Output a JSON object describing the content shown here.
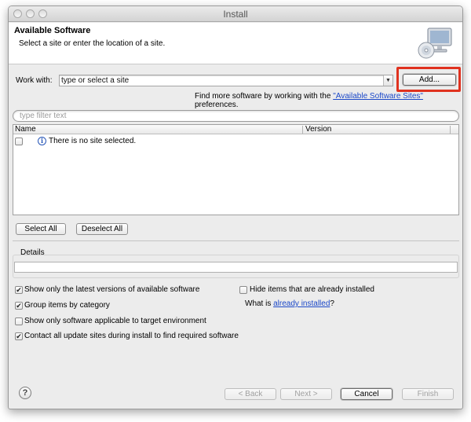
{
  "window": {
    "title": "Install"
  },
  "header": {
    "title": "Available Software",
    "subtitle": "Select a site or enter the location of a site.",
    "icon": "computer-cd-icon"
  },
  "work_with": {
    "label": "Work with:",
    "value": "type or select a site",
    "add_button": "Add..."
  },
  "find_more": {
    "prefix": "Find more software by working with the ",
    "link": "\"Available Software Sites\"",
    "suffix": " preferences."
  },
  "filter": {
    "placeholder": "type filter text"
  },
  "table": {
    "columns": [
      "Name",
      "Version"
    ],
    "empty_message": "There is no site selected."
  },
  "selection_buttons": {
    "select_all": "Select All",
    "deselect_all": "Deselect All"
  },
  "details": {
    "label": "Details"
  },
  "options": {
    "latest_versions": {
      "label": "Show only the latest versions of available software",
      "checked": true
    },
    "group_by_category": {
      "label": "Group items by category",
      "checked": true
    },
    "target_env": {
      "label": "Show only software applicable to target environment",
      "checked": false
    },
    "contact_sites": {
      "label": "Contact all update sites during install to find required software",
      "checked": true
    },
    "hide_installed": {
      "label": "Hide items that are already installed",
      "checked": false
    }
  },
  "what_is": {
    "prefix": "What is ",
    "link": "already installed",
    "suffix": "?"
  },
  "footer": {
    "back": "< Back",
    "next": "Next >",
    "cancel": "Cancel",
    "finish": "Finish"
  },
  "colors": {
    "highlight": "#e0321f",
    "link": "#1b48c8"
  }
}
